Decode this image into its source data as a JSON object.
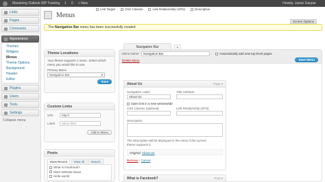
{
  "adminbar": {
    "site_title": "Mastering Outlook WP Training",
    "items": [
      "1",
      "0",
      "+ New"
    ],
    "user": "Howdy, Jason Gaspar"
  },
  "toolbar_links": [
    "Link Target",
    "CSS Classes",
    "Link Relationship (XFN)",
    "Description"
  ],
  "screen_options": "Screen Options",
  "help_label": "Help",
  "sidebar": {
    "items": [
      {
        "label": "Links"
      },
      {
        "label": "Pages"
      },
      {
        "label": "Comments"
      },
      {
        "label": "Appearance"
      },
      {
        "label": "Plugins"
      },
      {
        "label": "Users"
      },
      {
        "label": "Tools"
      },
      {
        "label": "Settings"
      },
      {
        "label": "Collapse menu"
      }
    ],
    "appearance_sub": [
      "Themes",
      "Widgets",
      "Menus",
      "Theme Options",
      "Background",
      "Header",
      "Editor"
    ]
  },
  "page": {
    "title": "Menus",
    "notice_bold": "Navigation Bar",
    "notice_pre": "The",
    "notice_post": "menu has been successfully created"
  },
  "theme_locations": {
    "title": "Theme Locations",
    "description": "Your theme supports 1 menu. Select which menu you would like to use.",
    "primary_label": "Primary Menu",
    "primary_value": "Navigation Bar",
    "save": "Save"
  },
  "custom_links": {
    "title": "Custom Links",
    "url_label": "URL",
    "url_value": "http://",
    "label_label": "Label",
    "label_placeholder": "Menu Item",
    "add": "Add to Menu"
  },
  "posts": {
    "title": "Posts",
    "tabs": [
      "Most Recent",
      "View All",
      "Search"
    ],
    "items": [
      "What is Facebook?",
      "More Website News",
      "Hello world!"
    ]
  },
  "menu_editor": {
    "tab_label": "Navigation Bar",
    "plus": "+",
    "name_label": "Menu Name",
    "name_value": "Navigation Bar",
    "auto_add": "Automatically add new top-level pages",
    "delete": "Delete Menu",
    "save": "Save Menu"
  },
  "menu_item_1": {
    "title": "About Us",
    "type": "Page",
    "nav_label": "Navigation Label",
    "nav_value": "About Us",
    "title_attr": "Title Attribute",
    "new_window": "Open link in a new window/tab",
    "css_label": "CSS Classes (optional)",
    "xfn_label": "Link Relationship (XFN)",
    "desc_label": "Description",
    "desc_help": "The description will be displayed in the menu if the current theme supports it.",
    "original_label": "Original:",
    "original_link": "About Us",
    "remove": "Remove",
    "cancel": "Cancel"
  },
  "menu_item_2": {
    "title": "What is Facebook?",
    "type": "Post"
  },
  "colors": {
    "link": "#21759b",
    "admin_bar": "#464646",
    "primary_button": "#2581b8",
    "notice_bg": "#ffffe0"
  }
}
